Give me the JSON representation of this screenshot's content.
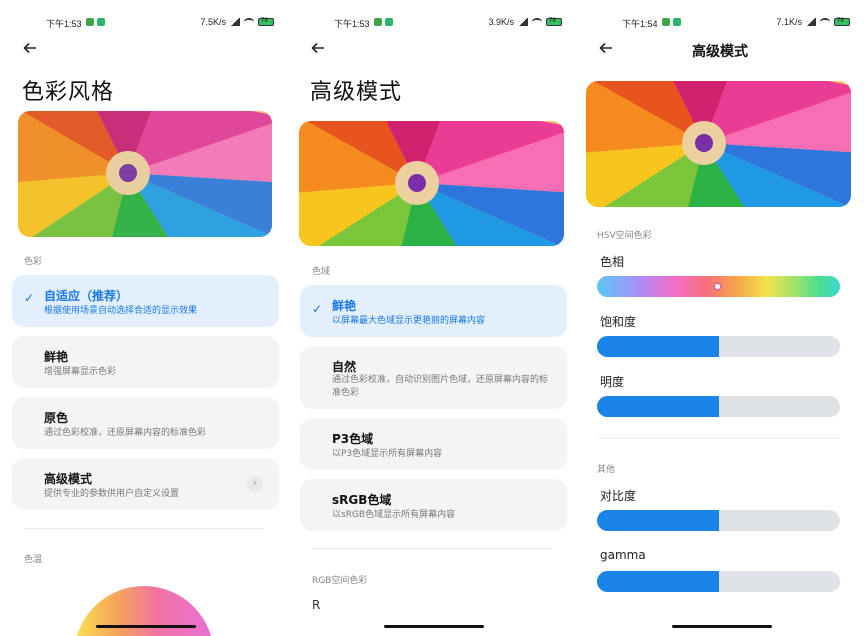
{
  "panels": [
    {
      "status": {
        "time": "下午1:53",
        "speed": "7.5K/s",
        "battery": "79"
      },
      "title": "色彩风格",
      "section_color": "色彩",
      "options": [
        {
          "title": "自适应（推荐）",
          "desc": "根据使用场景自动选择合适的显示效果",
          "selected": true
        },
        {
          "title": "鲜艳",
          "desc": "增强屏幕显示色彩"
        },
        {
          "title": "原色",
          "desc": "通过色彩校准，还原屏幕内容的标准色彩"
        },
        {
          "title": "高级模式",
          "desc": "提供专业的参数供用户自定义设置"
        }
      ],
      "section_temp": "色温"
    },
    {
      "status": {
        "time": "下午1:53",
        "speed": "3.9K/s",
        "battery": "79"
      },
      "title": "高级模式",
      "section_gamut": "色域",
      "options": [
        {
          "title": "鲜艳",
          "desc": "以屏幕最大色域显示更艳丽的屏幕内容",
          "selected": true
        },
        {
          "title": "自然",
          "desc": "通过色彩校准，自动识别图片色域，还原屏幕内容的标准色彩"
        },
        {
          "title": "P3色域",
          "desc": "以P3色域显示所有屏幕内容"
        },
        {
          "title": "sRGB色域",
          "desc": "以sRGB色域显示所有屏幕内容"
        }
      ],
      "section_rgb": "RGB空间色彩",
      "r_label": "R"
    },
    {
      "status": {
        "time": "下午1:54",
        "speed": "7.1K/s",
        "battery": "79"
      },
      "title": "高级模式",
      "section_hsv": "HSV空间色彩",
      "hue_label": "色相",
      "hue_value": 0.5,
      "saturation_label": "饱和度",
      "saturation_value": 0.5,
      "brightness_label": "明度",
      "brightness_value": 0.5,
      "section_other": "其他",
      "contrast_label": "对比度",
      "contrast_value": 0.5,
      "gamma_label": "gamma",
      "gamma_value": 0.5
    }
  ],
  "colors": {
    "accent": "#1677e6",
    "card": "#f3f4f6",
    "selected_card": "#e4effd",
    "slider_fill": "#1a84e8",
    "slider_track": "#dfe2e7"
  },
  "icons": {
    "back": "back-arrow-icon",
    "check": "check-icon",
    "chevron": "chevron-right-icon"
  }
}
